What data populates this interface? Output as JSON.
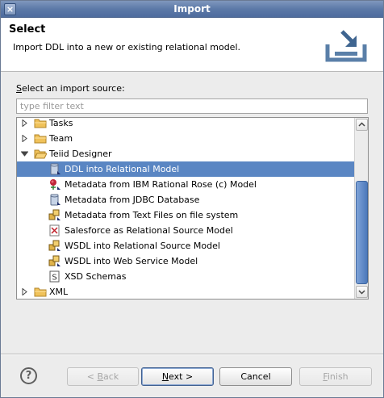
{
  "window": {
    "title": "Import",
    "close_glyph": "×"
  },
  "banner": {
    "title": "Select",
    "description": "Import DDL into a new or existing relational model.",
    "icon": "import-wizard-icon"
  },
  "source_label": {
    "mnemonic": "S",
    "rest": "elect an import source:"
  },
  "filter": {
    "placeholder": "type filter text",
    "value": ""
  },
  "tree": {
    "items": [
      {
        "label": "Tasks",
        "icon": "folder-icon",
        "expanded": false
      },
      {
        "label": "Team",
        "icon": "folder-icon",
        "expanded": false
      },
      {
        "label": "Teiid Designer",
        "icon": "folder-icon",
        "expanded": true
      },
      {
        "label": "DDL into Relational Model",
        "icon": "database-icon",
        "selected": true
      },
      {
        "label": "Metadata from IBM Rational Rose (c) Model",
        "icon": "rose-icon"
      },
      {
        "label": "Metadata from JDBC Database",
        "icon": "database-icon"
      },
      {
        "label": "Metadata from Text Files on file system",
        "icon": "package-icon"
      },
      {
        "label": "Salesforce as Relational Source Model",
        "icon": "salesforce-icon"
      },
      {
        "label": "WSDL into Relational Source Model",
        "icon": "package-icon"
      },
      {
        "label": "WSDL into Web Service Model",
        "icon": "package-icon"
      },
      {
        "label": "XSD Schemas",
        "icon": "xsd-icon"
      },
      {
        "label": "XML",
        "icon": "folder-icon",
        "expanded": false
      }
    ]
  },
  "buttons": {
    "help_glyph": "?",
    "back": {
      "pre": "< ",
      "mnemonic": "B",
      "post": "ack",
      "enabled": false
    },
    "next": {
      "pre": "",
      "mnemonic": "N",
      "post": "ext >",
      "enabled": true
    },
    "cancel": {
      "label": "Cancel",
      "enabled": true
    },
    "finish": {
      "pre": "",
      "mnemonic": "F",
      "post": "inish",
      "enabled": false
    }
  },
  "colors": {
    "titlebar": "#5c79a8",
    "selection": "#5a86c3",
    "scroll_thumb": "#4c79bb"
  }
}
